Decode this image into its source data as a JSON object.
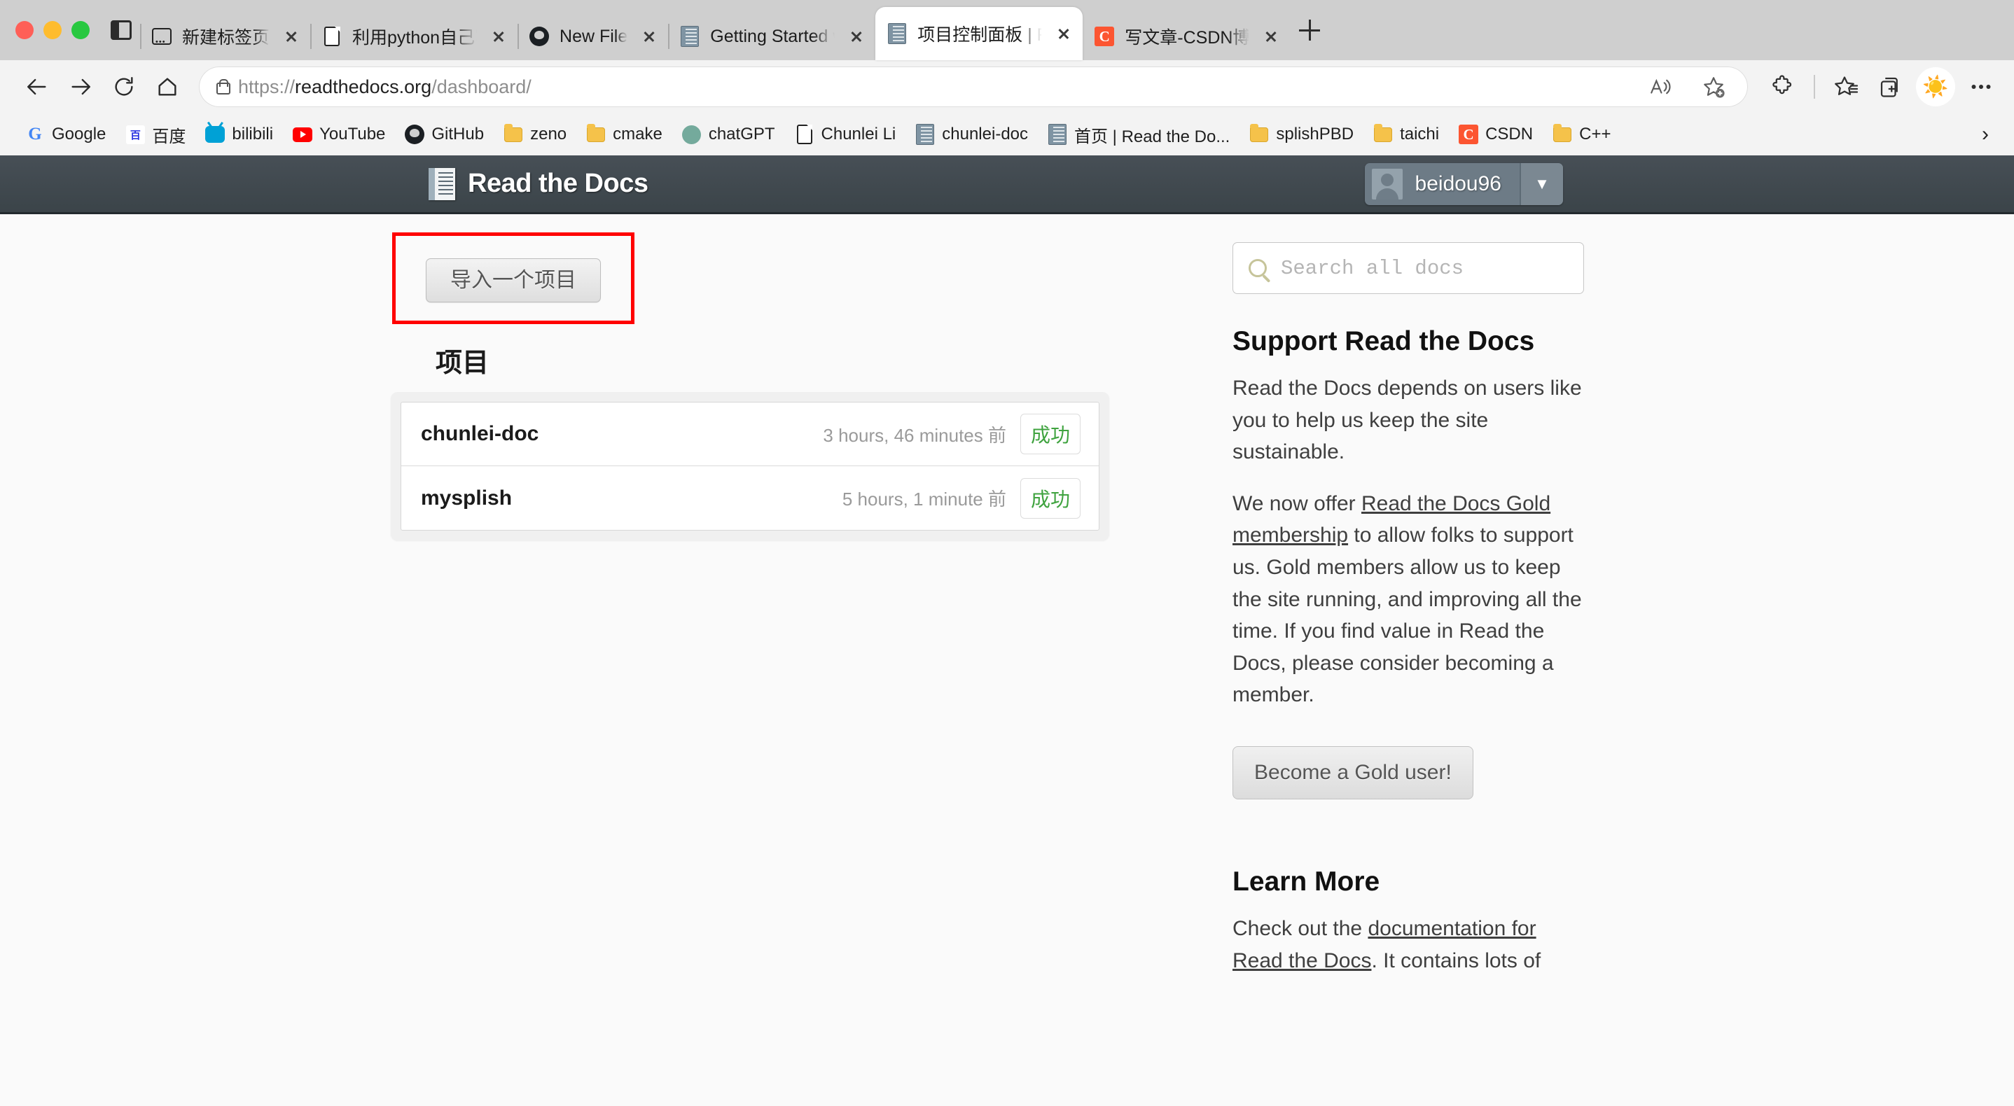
{
  "browser": {
    "window_controls": [
      "close",
      "minimize",
      "maximize"
    ],
    "sidebar_toggle_label": "Toggle sidebar",
    "tabs": [
      {
        "title": "新建标签页",
        "icon": "newtab-icon",
        "active": false
      },
      {
        "title": "利用python自己写个小脚本",
        "icon": "document-icon",
        "active": false
      },
      {
        "title": "New File",
        "icon": "github-icon",
        "active": false
      },
      {
        "title": "Getting Started with Sphinx",
        "icon": "readthedocs-icon",
        "active": false
      },
      {
        "title": "项目控制面板 | Read the Docs",
        "icon": "readthedocs-icon",
        "active": true
      },
      {
        "title": "写文章-CSDN博客",
        "icon": "csdn-icon",
        "active": false
      }
    ],
    "new_tab_label": "+",
    "nav": {
      "back": "←",
      "forward": "→",
      "reload": "⟳",
      "home": "⌂"
    },
    "omnibox": {
      "url_scheme": "https://",
      "url_host": "readthedocs.org",
      "url_path": "/dashboard/",
      "lock_icon": "lock-icon",
      "read_aloud_icon": "read-aloud-icon",
      "add_favorite_icon": "add-favorite-icon"
    },
    "toolbar_icons": [
      "extensions-icon",
      "favorites-icon",
      "collections-icon",
      "browser-essentials-icon",
      "settings-and-more-icon"
    ],
    "bookmarks": [
      {
        "label": "Google",
        "icon": "google-icon"
      },
      {
        "label": "百度",
        "icon": "baidu-icon"
      },
      {
        "label": "bilibili",
        "icon": "bilibili-icon"
      },
      {
        "label": "YouTube",
        "icon": "youtube-icon"
      },
      {
        "label": "GitHub",
        "icon": "github-icon"
      },
      {
        "label": "zeno",
        "icon": "folder-icon"
      },
      {
        "label": "cmake",
        "icon": "folder-icon"
      },
      {
        "label": "chatGPT",
        "icon": "chatgpt-icon"
      },
      {
        "label": "Chunlei Li",
        "icon": "document-icon"
      },
      {
        "label": "chunlei-doc",
        "icon": "readthedocs-icon"
      },
      {
        "label": "首页 | Read the Do...",
        "icon": "readthedocs-icon"
      },
      {
        "label": "splishPBD",
        "icon": "folder-icon"
      },
      {
        "label": "taichi",
        "icon": "folder-icon"
      },
      {
        "label": "CSDN",
        "icon": "csdn-icon"
      },
      {
        "label": "C++",
        "icon": "folder-icon"
      }
    ],
    "bookmarks_overflow": "›"
  },
  "site": {
    "header": {
      "logo_icon": "readthedocs-book-icon",
      "wordmark": "Read the Docs",
      "user": {
        "name": "beidou96",
        "avatar_icon": "avatar-icon",
        "caret_icon": "caret-down-icon"
      }
    },
    "main": {
      "import_button": "导入一个项目",
      "projects_heading": "项目",
      "projects": [
        {
          "name": "chunlei-doc",
          "time": "3 hours, 46 minutes 前",
          "status": "成功"
        },
        {
          "name": "mysplish",
          "time": "5 hours, 1 minute 前",
          "status": "成功"
        }
      ]
    },
    "sidebar": {
      "search": {
        "placeholder": "Search all docs",
        "icon": "search-icon",
        "value": ""
      },
      "support_heading": "Support Read the Docs",
      "support_p1": "Read the Docs depends on users like you to help us keep the site sustainable.",
      "support_p2_before": "We now offer ",
      "support_p2_link": "Read the Docs Gold membership",
      "support_p2_after": " to allow folks to support us. Gold members allow us to keep the site running, and improving all the time. If you find value in Read the Docs, please consider becoming a member.",
      "gold_button": "Become a Gold user!",
      "learn_heading": "Learn More",
      "learn_before": "Check out the ",
      "learn_link": "documentation for Read the Docs",
      "learn_after": ". It contains lots of"
    }
  },
  "colors": {
    "header_bg": "#414b52",
    "highlight_box": "#ff0000",
    "status_success": "#3fa33f",
    "csdn_red": "#fc5531",
    "chrome_bg": "#cfcfcf"
  }
}
